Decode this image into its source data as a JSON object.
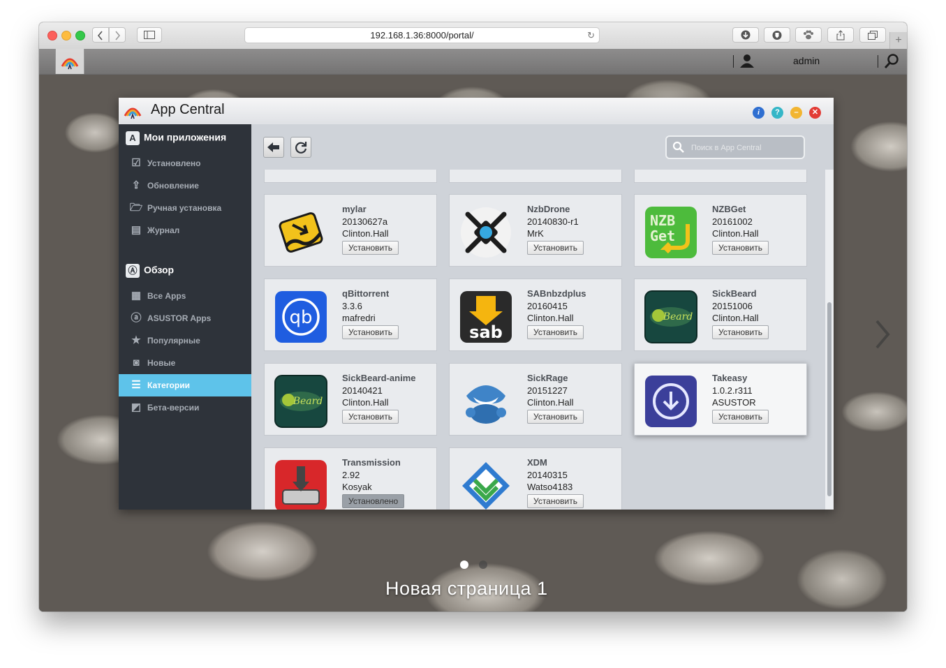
{
  "browser": {
    "url": "192.168.1.36:8000/portal/",
    "new_tab_label": "+"
  },
  "adm_bar": {
    "username": "admin"
  },
  "app_central": {
    "title": "App Central",
    "search_placeholder": "Поиск в App Central",
    "sidebar": {
      "my_apps_header": "Мои приложения",
      "my_apps_items": [
        {
          "label": "Установлено",
          "icon": "installed-icon"
        },
        {
          "label": "Обновление",
          "icon": "update-icon"
        },
        {
          "label": "Ручная установка",
          "icon": "folder-open-icon"
        },
        {
          "label": "Журнал",
          "icon": "log-icon"
        }
      ],
      "browse_header": "Обзор",
      "browse_items": [
        {
          "label": "Все Apps",
          "icon": "grid-icon",
          "active": false
        },
        {
          "label": "ASUSTOR Apps",
          "icon": "asustor-icon",
          "active": false
        },
        {
          "label": "Популярные",
          "icon": "star-icon",
          "active": false
        },
        {
          "label": "Новые",
          "icon": "new-icon",
          "active": false
        },
        {
          "label": "Категории",
          "icon": "list-icon",
          "active": true
        },
        {
          "label": "Бета-версии",
          "icon": "beta-icon",
          "active": false
        }
      ]
    },
    "apps": [
      {
        "name": "mylar",
        "version": "20130627a",
        "author": "Clinton.Hall",
        "action": "Установить",
        "icon": "mylar-icon"
      },
      {
        "name": "NzbDrone",
        "version": "20140830-r1",
        "author": "MrK",
        "action": "Установить",
        "icon": "nzbdrone-icon"
      },
      {
        "name": "NZBGet",
        "version": "20161002",
        "author": "Clinton.Hall",
        "action": "Установить",
        "icon": "nzbget-icon"
      },
      {
        "name": "qBittorrent",
        "version": "3.3.6",
        "author": "mafredri",
        "action": "Установить",
        "icon": "qbittorrent-icon"
      },
      {
        "name": "SABnbzdplus",
        "version": "20160415",
        "author": "Clinton.Hall",
        "action": "Установить",
        "icon": "sabnzbd-icon"
      },
      {
        "name": "SickBeard",
        "version": "20151006",
        "author": "Clinton.Hall",
        "action": "Установить",
        "icon": "sickbeard-icon"
      },
      {
        "name": "SickBeard-anime",
        "version": "20140421",
        "author": "Clinton.Hall",
        "action": "Установить",
        "icon": "sickbeard-anime-icon"
      },
      {
        "name": "SickRage",
        "version": "20151227",
        "author": "Clinton.Hall",
        "action": "Установить",
        "icon": "sickrage-icon"
      },
      {
        "name": "Takeasy",
        "version": "1.0.2.r311",
        "author": "ASUSTOR",
        "action": "Установить",
        "icon": "takeasy-icon"
      },
      {
        "name": "Transmission",
        "version": "2.92",
        "author": "Kosyak",
        "action": "Установлено",
        "icon": "transmission-icon"
      },
      {
        "name": "XDM",
        "version": "20140315",
        "author": "Watso4183",
        "action": "Установить",
        "icon": "xdm-icon"
      }
    ]
  },
  "desktop": {
    "page_label": "Новая страница 1",
    "current_page": 1,
    "page_count": 2
  },
  "colors": {
    "sidebar_bg": "#2e333a",
    "active_item": "#5ec3ea"
  }
}
